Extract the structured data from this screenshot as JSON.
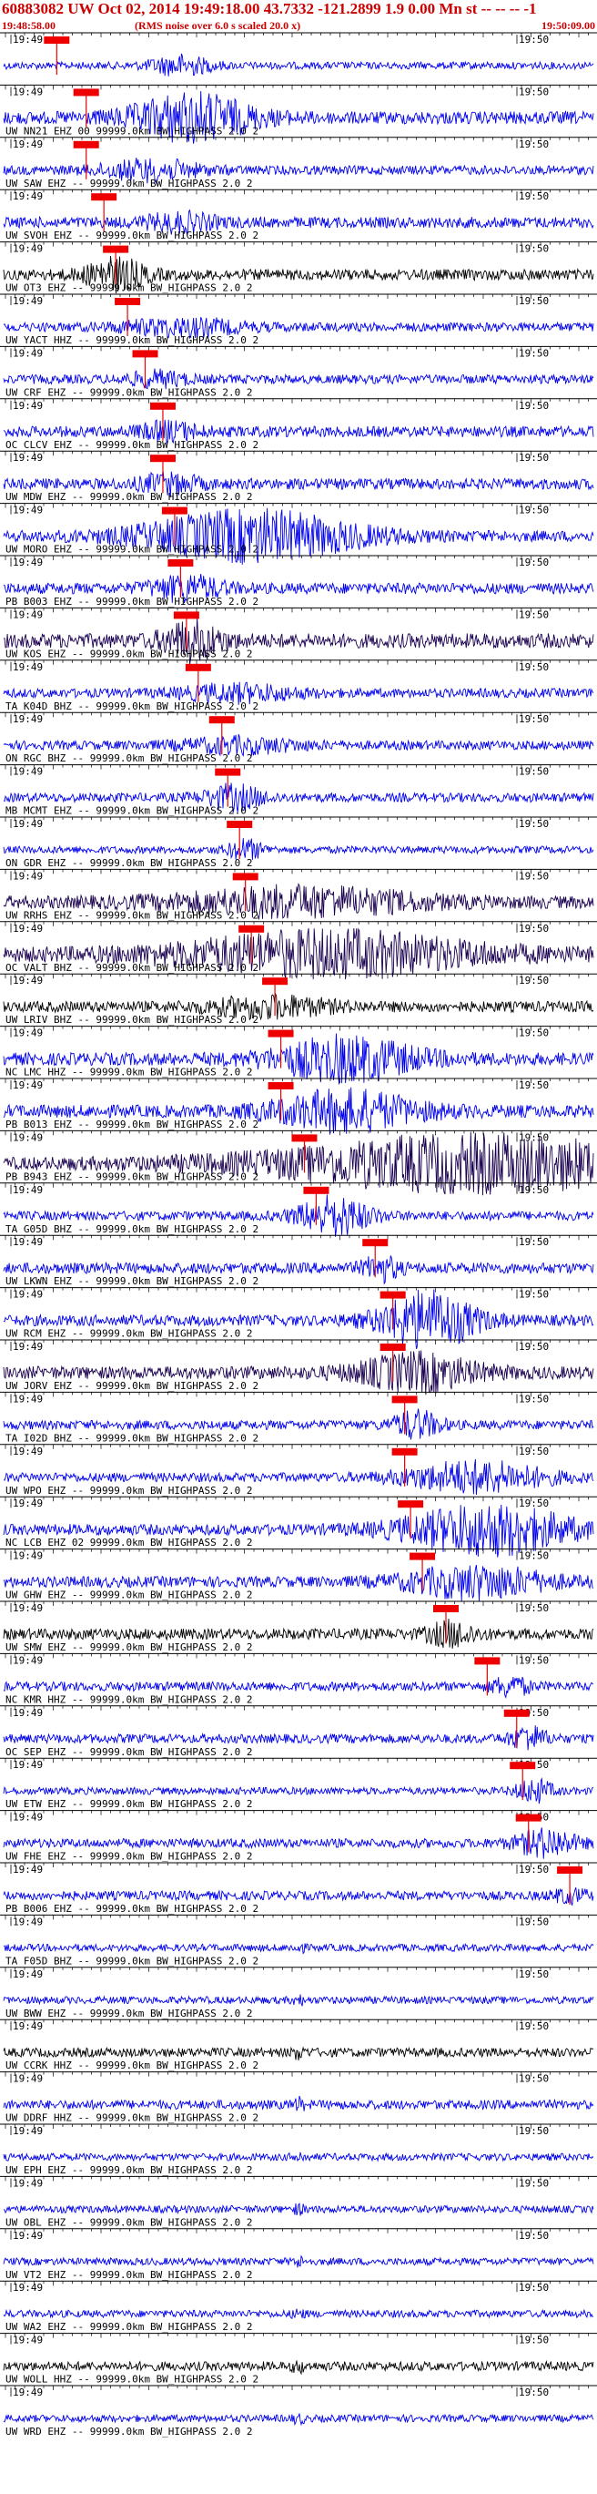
{
  "header": {
    "title": "60883082 UW Oct 02, 2014 19:49:18.00   43.7332 -121.2899  1.9 0.00 Mn st -- -- -- -1",
    "start_time": "19:48:58.00",
    "note": "(RMS noise over 6.0 s scaled 20.0 x)",
    "end_time": "19:50:09.00"
  },
  "tick_left": "19:49",
  "tick_right": "19:50",
  "colors": {
    "blue": "#0000ee",
    "dark": "#1a0050",
    "black": "#000000",
    "red": "#ee0000"
  },
  "traces": [
    {
      "label": "",
      "color": "blue",
      "amp": 4,
      "burst_at": 0.3,
      "burst_amp": 10,
      "burst_w": 0.05,
      "pick": 0.09
    },
    {
      "label": "UW NN21 EHZ 00 99999.0km BW_HIGHPASS  2.0  2",
      "color": "blue",
      "amp": 7,
      "burst_at": 0.32,
      "burst_amp": 24,
      "burst_w": 0.1,
      "pick": 0.14
    },
    {
      "label": "UW SAW EHZ -- 99999.0km BW_HIGHPASS  2.0  2",
      "color": "blue",
      "amp": 5,
      "burst_at": 0.25,
      "burst_amp": 10,
      "burst_w": 0.08,
      "pick": 0.14
    },
    {
      "label": "UW SVOH EHZ -- 99999.0km BW_HIGHPASS  2.0  2",
      "color": "blue",
      "amp": 6,
      "burst_at": 0.3,
      "burst_amp": 8,
      "burst_w": 0.06,
      "pick": 0.17
    },
    {
      "label": "UW OT3 EHZ -- 99999.0km BW_HIGHPASS  2.0  2",
      "color": "black",
      "amp": 6,
      "burst_at": 0.19,
      "burst_amp": 16,
      "burst_w": 0.05,
      "pick": 0.19
    },
    {
      "label": "UW YACT HHZ -- 99999.0km BW_HIGHPASS  2.0  2",
      "color": "blue",
      "amp": 5,
      "burst_at": 0.3,
      "burst_amp": 8,
      "burst_w": 0.1,
      "pick": 0.21
    },
    {
      "label": "UW CRF EHZ -- 99999.0km BW_HIGHPASS  2.0  2",
      "color": "blue",
      "amp": 5,
      "burst_at": 0.26,
      "burst_amp": 7,
      "burst_w": 0.05,
      "pick": 0.24
    },
    {
      "label": "OC CLCV EHZ -- 99999.0km BW_HIGHPASS  2.0  2",
      "color": "blue",
      "amp": 6,
      "burst_at": 0.28,
      "burst_amp": 8,
      "burst_w": 0.05,
      "pick": 0.27
    },
    {
      "label": "UW MDW EHZ -- 99999.0km BW_HIGHPASS  2.0  2",
      "color": "blue",
      "amp": 6,
      "burst_at": 0.28,
      "burst_amp": 9,
      "burst_w": 0.05,
      "pick": 0.27
    },
    {
      "label": "UW MORO EHZ -- 99999.0km BW_HIGHPASS  2.0  2",
      "color": "blue",
      "amp": 6,
      "burst_at": 0.42,
      "burst_amp": 26,
      "burst_w": 0.18,
      "pick": 0.29
    },
    {
      "label": "PB B003 EHZ -- 99999.0km BW_HIGHPASS  2.0  2",
      "color": "blue",
      "amp": 6,
      "burst_at": 0.31,
      "burst_amp": 12,
      "burst_w": 0.06,
      "pick": 0.3
    },
    {
      "label": "UW KOS EHZ -- 99999.0km BW_HIGHPASS  2.0  2",
      "color": "dark",
      "amp": 8,
      "burst_at": 0.32,
      "burst_amp": 18,
      "burst_w": 0.05,
      "pick": 0.31
    },
    {
      "label": "TA K04D BHZ -- 99999.0km BW_HIGHPASS  2.0  2",
      "color": "blue",
      "amp": 5,
      "burst_at": 0.4,
      "burst_amp": 8,
      "burst_w": 0.1,
      "pick": 0.33
    },
    {
      "label": "ON RGC BHZ -- 99999.0km BW_HIGHPASS  2.0  2",
      "color": "blue",
      "amp": 5,
      "burst_at": 0.4,
      "burst_amp": 7,
      "burst_w": 0.1,
      "pick": 0.37
    },
    {
      "label": "MB MCMT EHZ -- 99999.0km BW_HIGHPASS  2.0  2",
      "color": "blue",
      "amp": 5,
      "burst_at": 0.39,
      "burst_amp": 12,
      "burst_w": 0.05,
      "pick": 0.38
    },
    {
      "label": "ON GDR EHZ -- 99999.0km BW_HIGHPASS  2.0  2",
      "color": "blue",
      "amp": 4,
      "burst_at": 0.41,
      "burst_amp": 10,
      "burst_w": 0.03,
      "pick": 0.4
    },
    {
      "label": "UW RRHS EHZ -- 99999.0km BW_HIGHPASS  2.0  2",
      "color": "dark",
      "amp": 7,
      "burst_at": 0.5,
      "burst_amp": 14,
      "burst_w": 0.2,
      "pick": 0.41
    },
    {
      "label": "OC VALT BHZ -- 99999.0km BW_HIGHPASS  2.0  2",
      "color": "dark",
      "amp": 8,
      "burst_at": 0.55,
      "burst_amp": 22,
      "burst_w": 0.25,
      "pick": 0.42
    },
    {
      "label": "UW LRIV BHZ -- 99999.0km BW_HIGHPASS  2.0  2",
      "color": "black",
      "amp": 6,
      "burst_at": 0.45,
      "burst_amp": 10,
      "burst_w": 0.1,
      "pick": 0.46
    },
    {
      "label": "NC LMC HHZ -- 99999.0km BW_HIGHPASS  2.0  2",
      "color": "blue",
      "amp": 7,
      "burst_at": 0.58,
      "burst_amp": 22,
      "burst_w": 0.12,
      "pick": 0.47
    },
    {
      "label": "PB B013 EHZ -- 99999.0km BW_HIGHPASS  2.0  2",
      "color": "blue",
      "amp": 7,
      "burst_at": 0.58,
      "burst_amp": 20,
      "burst_w": 0.12,
      "pick": 0.47
    },
    {
      "label": "PB B943 EHZ -- 99999.0km BW_HIGHPASS  2.0  2",
      "color": "dark",
      "amp": 7,
      "burst_at": 0.8,
      "burst_amp": 28,
      "burst_w": 0.35,
      "pick": 0.51
    },
    {
      "label": "TA G05D BHZ -- 99999.0km BW_HIGHPASS  2.0  2",
      "color": "blue",
      "amp": 5,
      "burst_at": 0.56,
      "burst_amp": 20,
      "burst_w": 0.06,
      "pick": 0.53
    },
    {
      "label": "UW LKWN EHZ -- 99999.0km BW_HIGHPASS  2.0  2",
      "color": "blue",
      "amp": 6,
      "burst_at": 0.64,
      "burst_amp": 12,
      "burst_w": 0.03,
      "pick": 0.63
    },
    {
      "label": "UW RCM EHZ -- 99999.0km BW_HIGHPASS  2.0  2",
      "color": "blue",
      "amp": 6,
      "burst_at": 0.72,
      "burst_amp": 30,
      "burst_w": 0.08,
      "pick": 0.66
    },
    {
      "label": "UW JORV EHZ -- 99999.0km BW_HIGHPASS  2.0  2",
      "color": "dark",
      "amp": 7,
      "burst_at": 0.7,
      "burst_amp": 18,
      "burst_w": 0.1,
      "pick": 0.66
    },
    {
      "label": "TA I02D BHZ -- 99999.0km BW_HIGHPASS  2.0  2",
      "color": "blue",
      "amp": 5,
      "burst_at": 0.7,
      "burst_amp": 14,
      "burst_w": 0.04,
      "pick": 0.68
    },
    {
      "label": "UW WPO EHZ -- 99999.0km BW_HIGHPASS  2.0  2",
      "color": "blue",
      "amp": 5,
      "burst_at": 0.8,
      "burst_amp": 16,
      "burst_w": 0.12,
      "pick": 0.68
    },
    {
      "label": "NC LCB EHZ 02 99999.0km BW_HIGHPASS  2.0  2",
      "color": "blue",
      "amp": 6,
      "burst_at": 0.82,
      "burst_amp": 26,
      "burst_w": 0.14,
      "pick": 0.69
    },
    {
      "label": "UW GHW EHZ -- 99999.0km BW_HIGHPASS  2.0  2",
      "color": "blue",
      "amp": 6,
      "burst_at": 0.8,
      "burst_amp": 16,
      "burst_w": 0.12,
      "pick": 0.71
    },
    {
      "label": "UW SMW EHZ -- 99999.0km BW_HIGHPASS  2.0  2",
      "color": "black",
      "amp": 6,
      "burst_at": 0.76,
      "burst_amp": 12,
      "burst_w": 0.04,
      "pick": 0.75
    },
    {
      "label": "NC KMR HHZ -- 99999.0km BW_HIGHPASS  2.0  2",
      "color": "blue",
      "amp": 5,
      "burst_at": 0.86,
      "burst_amp": 10,
      "burst_w": 0.03,
      "pick": 0.82
    },
    {
      "label": "OC SEP EHZ -- 99999.0km BW_HIGHPASS  2.0  2",
      "color": "blue",
      "amp": 5,
      "burst_at": 0.89,
      "burst_amp": 12,
      "burst_w": 0.03,
      "pick": 0.87
    },
    {
      "label": "UW ETW EHZ -- 99999.0km BW_HIGHPASS  2.0  2",
      "color": "blue",
      "amp": 4,
      "burst_at": 0.9,
      "burst_amp": 12,
      "burst_w": 0.03,
      "pick": 0.88
    },
    {
      "label": "UW FHE EHZ -- 99999.0km BW_HIGHPASS  2.0  2",
      "color": "blue",
      "amp": 5,
      "burst_at": 0.92,
      "burst_amp": 14,
      "burst_w": 0.05,
      "pick": 0.89
    },
    {
      "label": "PB B006 EHZ -- 99999.0km BW_HIGHPASS  2.0  2",
      "color": "blue",
      "amp": 5,
      "burst_at": 0.96,
      "burst_amp": 6,
      "burst_w": 0.03,
      "pick": 0.96
    },
    {
      "label": "TA F05D BHZ -- 99999.0km BW_HIGHPASS  2.0  2",
      "color": "blue",
      "amp": 4,
      "burst_at": 0.5,
      "burst_amp": 4,
      "burst_w": 0.01,
      "pick": null
    },
    {
      "label": "UW BWW EHZ -- 99999.0km BW_HIGHPASS  2.0  2",
      "color": "blue",
      "amp": 4,
      "burst_at": 0.5,
      "burst_amp": 4,
      "burst_w": 0.01,
      "pick": null
    },
    {
      "label": "UW CCRK HHZ -- 99999.0km BW_HIGHPASS  2.0  2",
      "color": "black",
      "amp": 5,
      "burst_at": 0.5,
      "burst_amp": 5,
      "burst_w": 0.01,
      "pick": null
    },
    {
      "label": "UW DDRF HHZ -- 99999.0km BW_HIGHPASS  2.0  2",
      "color": "blue",
      "amp": 5,
      "burst_at": 0.5,
      "burst_amp": 5,
      "burst_w": 0.01,
      "pick": null
    },
    {
      "label": "UW EPH EHZ -- 99999.0km BW_HIGHPASS  2.0  2",
      "color": "blue",
      "amp": 4,
      "burst_at": 0.5,
      "burst_amp": 4,
      "burst_w": 0.01,
      "pick": null
    },
    {
      "label": "UW OBL EHZ -- 99999.0km BW_HIGHPASS  2.0  2",
      "color": "blue",
      "amp": 4,
      "burst_at": 0.5,
      "burst_amp": 4,
      "burst_w": 0.01,
      "pick": null
    },
    {
      "label": "UW VT2 EHZ -- 99999.0km BW_HIGHPASS  2.0  2",
      "color": "blue",
      "amp": 4,
      "burst_at": 0.5,
      "burst_amp": 4,
      "burst_w": 0.01,
      "pick": null
    },
    {
      "label": "UW WA2 EHZ -- 99999.0km BW_HIGHPASS  2.0  2",
      "color": "blue",
      "amp": 4,
      "burst_at": 0.5,
      "burst_amp": 4,
      "burst_w": 0.01,
      "pick": null
    },
    {
      "label": "UW WOLL HHZ -- 99999.0km BW_HIGHPASS  2.0  2",
      "color": "black",
      "amp": 5,
      "burst_at": 0.5,
      "burst_amp": 5,
      "burst_w": 0.01,
      "pick": null
    },
    {
      "label": "UW WRD EHZ -- 99999.0km BW_HIGHPASS  2.0  2",
      "color": "blue",
      "amp": 4,
      "burst_at": 0.5,
      "burst_amp": 4,
      "burst_w": 0.01,
      "pick": null
    }
  ]
}
